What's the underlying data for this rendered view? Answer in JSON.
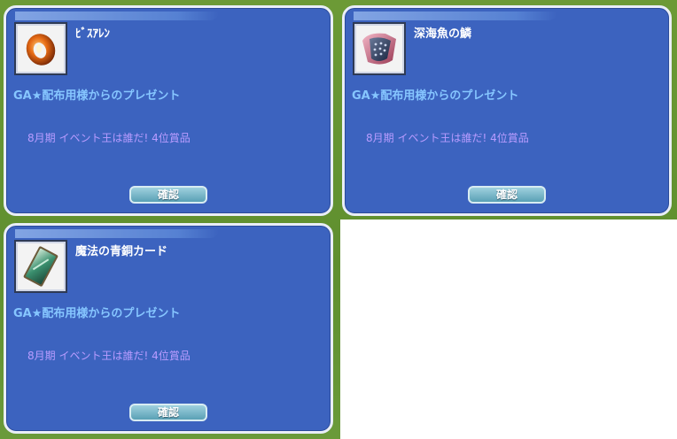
{
  "dialogs": [
    {
      "item_name": "ﾋﾞｽｱﾚﾝ",
      "icon": "orange-ring-icon",
      "sender": "GA★配布用様からのプレゼント",
      "message": "8月期 イベント王は誰だ! 4位賞品",
      "confirm_label": "確認"
    },
    {
      "item_name": "深海魚の鱗",
      "icon": "fish-scale-shield-icon",
      "sender": "GA★配布用様からのプレゼント",
      "message": "8月期 イベント王は誰だ! 4位賞品",
      "confirm_label": "確認"
    },
    {
      "item_name": "魔法の青銅カード",
      "icon": "bronze-card-icon",
      "sender": "GA★配布用様からのプレゼント",
      "message": "8月期 イベント王は誰だ! 4位賞品",
      "confirm_label": "確認"
    }
  ],
  "colors": {
    "dialog_bg": "#3c63bf",
    "sender_text": "#86c6ff",
    "message_text": "#b99cff",
    "button_bg": "#5aa0b5"
  }
}
